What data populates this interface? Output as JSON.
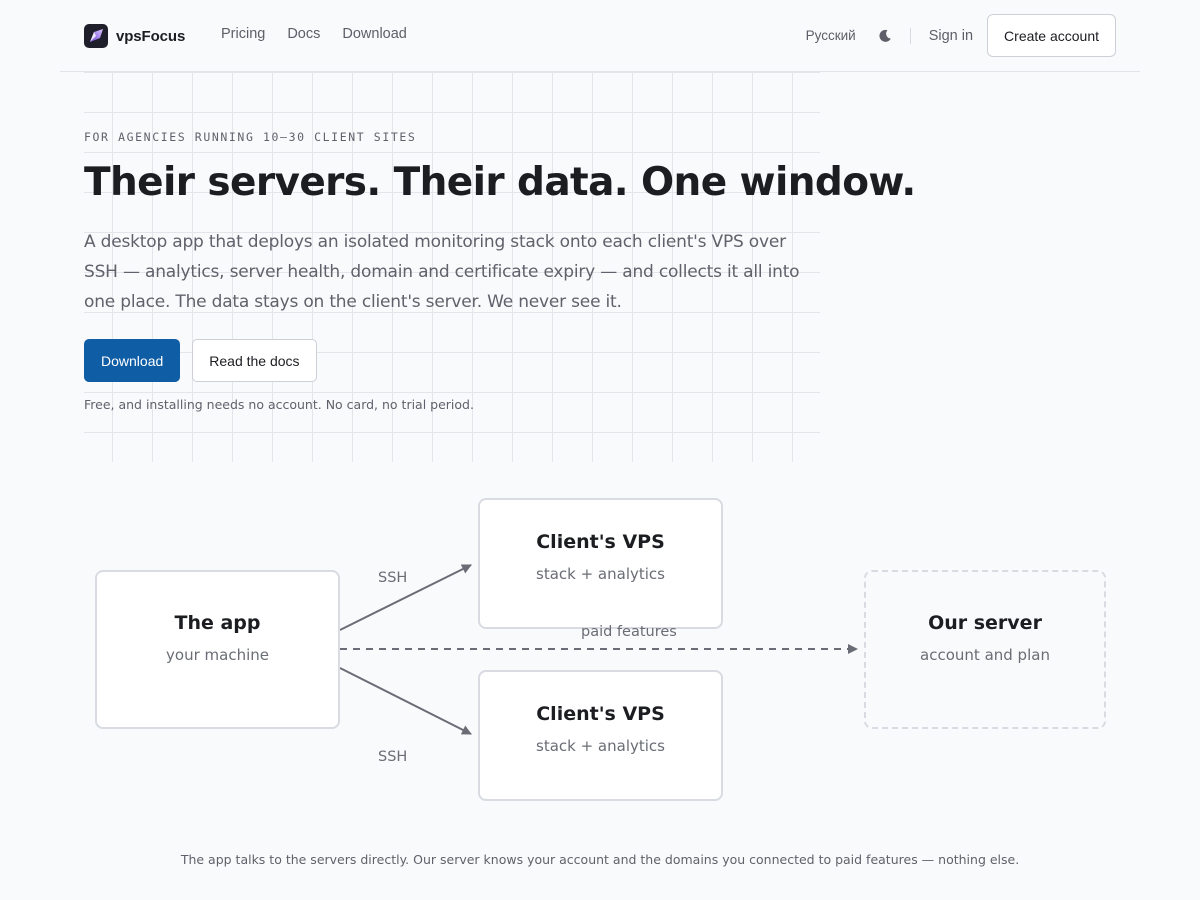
{
  "header": {
    "brand": "vpsFocus",
    "nav": [
      "Pricing",
      "Docs",
      "Download"
    ],
    "language": "Русский",
    "sign_in": "Sign in",
    "create_account": "Create account"
  },
  "hero": {
    "eyebrow": "FOR AGENCIES RUNNING 10–30 CLIENT SITES",
    "headline": "Their servers. Their data. One window.",
    "lede": "A desktop app that deploys an isolated monitoring stack onto each client's VPS over SSH — analytics, server health, domain and certificate expiry — and collects it all into one place. The data stays on the client's server. We never see it.",
    "download_label": "Download",
    "docs_label": "Read the docs",
    "note": "Free, and installing needs no account. No card, no trial period."
  },
  "diagram": {
    "app": {
      "title": "The app",
      "subtitle": "your machine"
    },
    "vps_top": {
      "title": "Client's VPS",
      "subtitle": "stack + analytics"
    },
    "vps_bottom": {
      "title": "Client's VPS",
      "subtitle": "stack + analytics"
    },
    "our_server": {
      "title": "Our server",
      "subtitle": "account and plan"
    },
    "edge_ssh_top": "SSH",
    "edge_ssh_bottom": "SSH",
    "edge_paid": "paid features",
    "caption": "The app talks to the servers directly. Our server knows your account and the domains you connected to paid features — nothing else."
  },
  "icons": {
    "logo": "vpsfocus-logo-icon",
    "theme": "moon-icon"
  },
  "colors": {
    "primary": "#0f5da4",
    "background": "#f9fafc",
    "text": "#1c1d21",
    "muted": "#5f626b"
  }
}
